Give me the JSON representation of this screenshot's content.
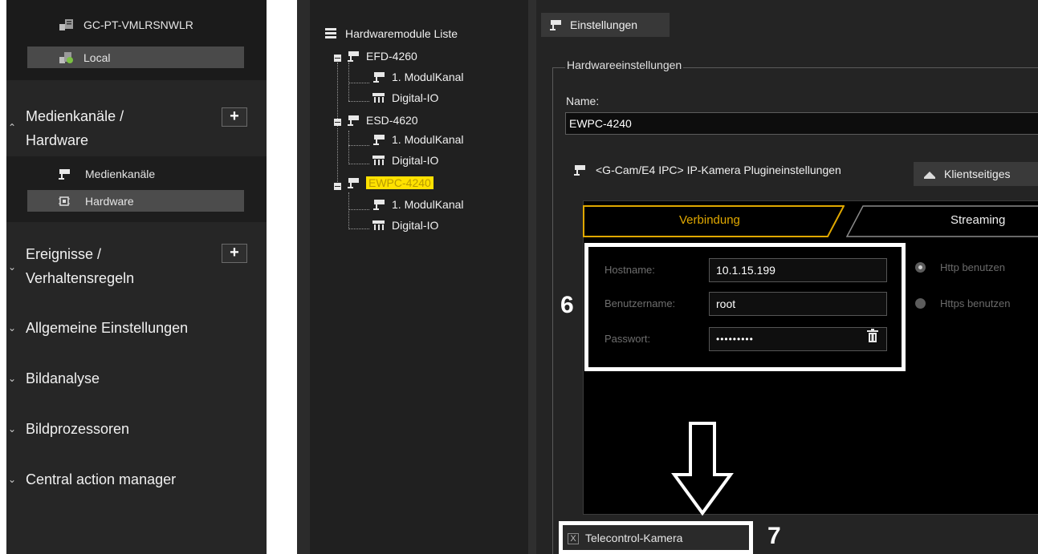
{
  "servers": [
    {
      "label": "GC-PT-VMLRSNWLR",
      "icon": "server-icon"
    },
    {
      "label": "Local",
      "icon": "local-server-icon"
    }
  ],
  "sections": [
    {
      "title_line1": "Medienkanäle /",
      "title_line2": "Hardware",
      "expanded": true,
      "has_add": true,
      "add_label": "+"
    },
    {
      "title_line1": "Ereignisse /",
      "title_line2": "Verhaltensregeln",
      "expanded": false,
      "has_add": true,
      "add_label": "+"
    },
    {
      "title_line1": "Allgemeine Einstellungen",
      "expanded": false
    },
    {
      "title_line1": "Bildanalyse",
      "expanded": false
    },
    {
      "title_line1": "Bildprozessoren",
      "expanded": false
    },
    {
      "title_line1": "Central action manager",
      "expanded": false
    }
  ],
  "media_sub": [
    {
      "label": "Medienkanäle",
      "icon": "camera-icon",
      "selected": false
    },
    {
      "label": "Hardware",
      "icon": "chip-icon",
      "selected": true
    }
  ],
  "tree": {
    "root": "Hardwaremodule Liste",
    "modules": [
      {
        "label": "EFD-4260",
        "highlighted": false,
        "children": [
          "1. ModulKanal",
          "Digital-IO"
        ]
      },
      {
        "label": "ESD-4620",
        "highlighted": false,
        "children": [
          "1. ModulKanal",
          "Digital-IO"
        ]
      },
      {
        "label": "EWPC-4240",
        "highlighted": true,
        "children": [
          "1. ModulKanal",
          "Digital-IO"
        ]
      }
    ]
  },
  "settings": {
    "tab_label": "Einstellungen",
    "group_label": "Hardwareeinstellungen",
    "name_label": "Name:",
    "name_value": "EWPC-4240",
    "plugin_tab": "<G-Cam/E4 IPC> IP-Kamera Plugineinstellungen",
    "client_tab": "Klientseitiges",
    "subtabs": {
      "connection": "Verbindung",
      "streaming": "Streaming"
    },
    "hostname_label": "Hostname:",
    "hostname_value": "10.1.15.199",
    "user_label": "Benutzername:",
    "user_value": "root",
    "password_label": "Passwort:",
    "password_value": "•••••••••",
    "http_label": "Http benutzen",
    "https_label": "Https benutzen",
    "telecontrol_label": "Telecontrol-Kamera",
    "telecontrol_checked": true,
    "telecontrol_mark": "X"
  },
  "annotations": {
    "step_fields": "6",
    "step_checkbox": "7"
  },
  "colors": {
    "accent": "#e0a800",
    "highlight": "#ffe100",
    "panel": "#242424"
  }
}
